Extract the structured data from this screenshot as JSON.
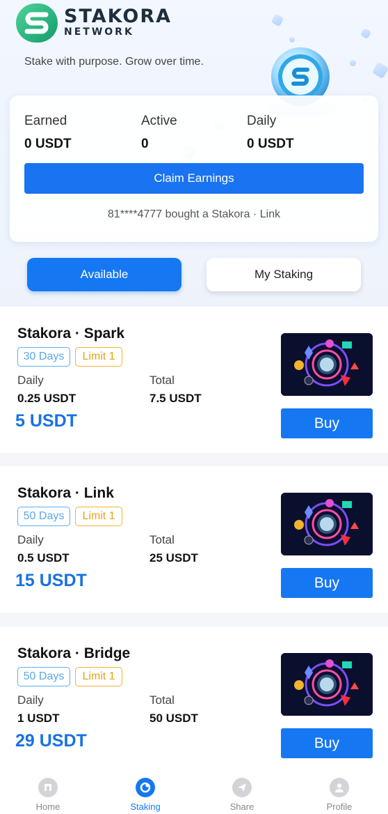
{
  "brand": {
    "name": "STAKORA",
    "sub": "NETWORK",
    "tagline": "Stake with purpose. Grow over time."
  },
  "stats": {
    "earned_label": "Earned",
    "earned_value": "0 USDT",
    "active_label": "Active",
    "active_value": "0",
    "daily_label": "Daily",
    "daily_value": "0 USDT",
    "claim_label": "Claim Earnings",
    "ticker": "81****4777 bought a Stakora · Link"
  },
  "tabs": {
    "available": "Available",
    "my_staking": "My Staking"
  },
  "products": [
    {
      "title": "Stakora · Spark",
      "days": "30 Days",
      "limit": "Limit 1",
      "daily_label": "Daily",
      "daily": "0.25 USDT",
      "total_label": "Total",
      "total": "7.5 USDT",
      "price": "5 USDT",
      "buy": "Buy"
    },
    {
      "title": "Stakora · Link",
      "days": "50 Days",
      "limit": "Limit 1",
      "daily_label": "Daily",
      "daily": "0.5 USDT",
      "total_label": "Total",
      "total": "25 USDT",
      "price": "15 USDT",
      "buy": "Buy"
    },
    {
      "title": "Stakora · Bridge",
      "days": "50 Days",
      "limit": "Limit 1",
      "daily_label": "Daily",
      "daily": "1 USDT",
      "total_label": "Total",
      "total": "50 USDT",
      "price": "29 USDT",
      "buy": "Buy"
    }
  ],
  "nav": [
    {
      "label": "Home",
      "icon": "home-icon"
    },
    {
      "label": "Staking",
      "icon": "staking-icon"
    },
    {
      "label": "Share",
      "icon": "share-icon"
    },
    {
      "label": "Profile",
      "icon": "profile-icon"
    }
  ],
  "colors": {
    "accent": "#1677f2",
    "price": "#1672e6",
    "days_tag": "#5aa6e6",
    "limit_tag": "#e9a20f",
    "logo_green": "#22b07e"
  }
}
